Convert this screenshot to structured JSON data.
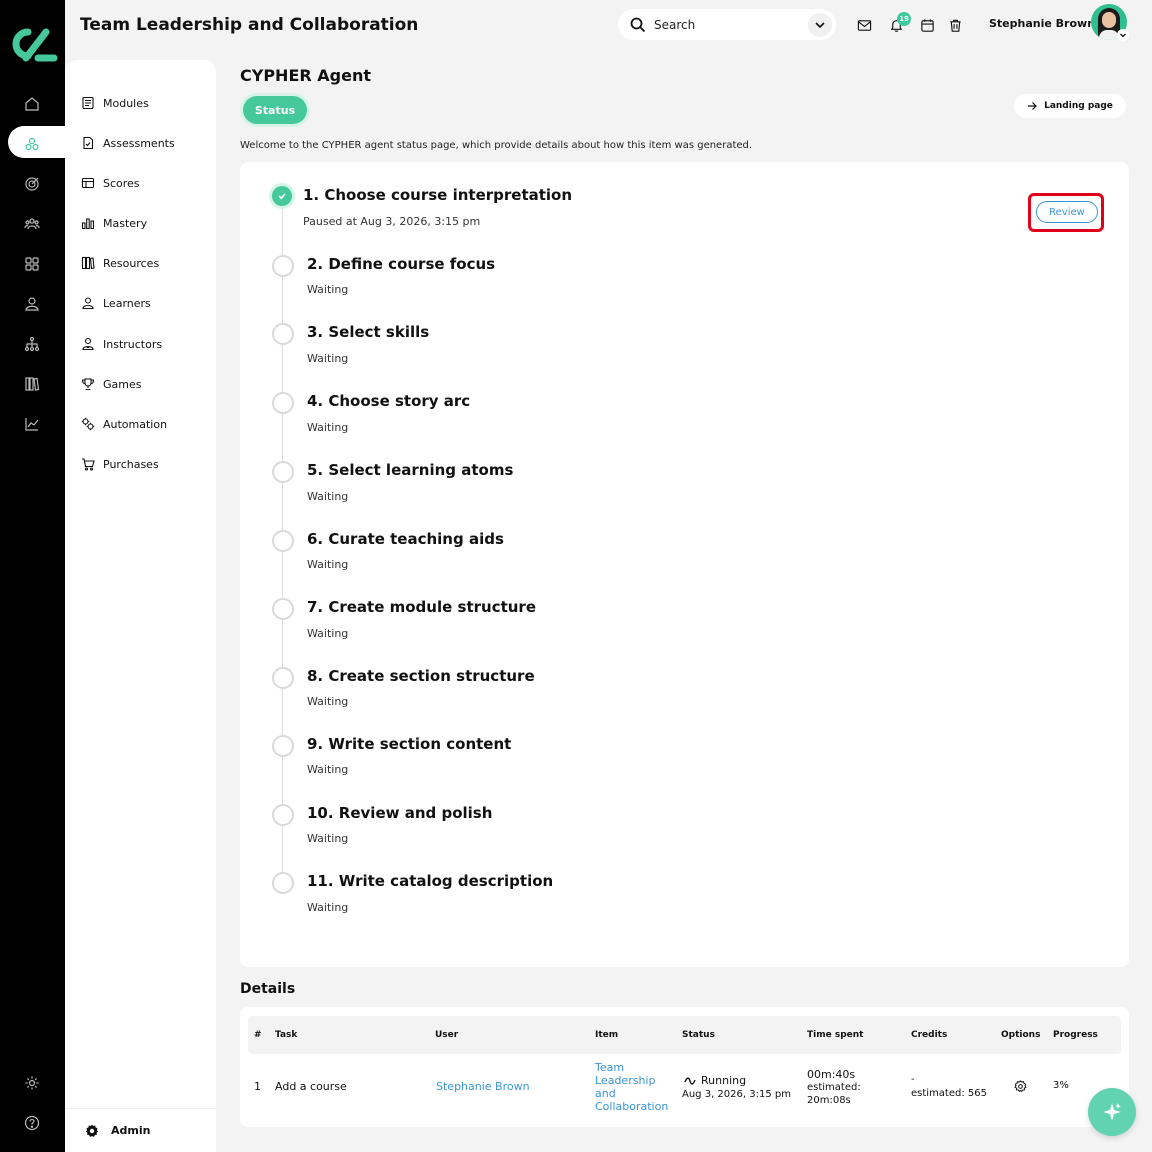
{
  "header": {
    "title": "Team Leadership and Collaboration",
    "search_placeholder": "Search",
    "notification_count": "19",
    "user_name": "Stephanie Brown"
  },
  "colors": {
    "accent": "#45c99b",
    "link": "#3a95d6",
    "highlight": "#e0001b"
  },
  "rail_icons": [
    "home-icon",
    "modules-icon",
    "target-icon",
    "people-icon",
    "grid-icon",
    "user-icon",
    "hierarchy-icon",
    "library-icon",
    "chart-icon",
    "settings-icon",
    "help-icon"
  ],
  "sidebar": {
    "items": [
      {
        "label": "Modules",
        "icon": "modules-icon"
      },
      {
        "label": "Assessments",
        "icon": "assessments-icon"
      },
      {
        "label": "Scores",
        "icon": "scores-icon"
      },
      {
        "label": "Mastery",
        "icon": "mastery-icon"
      },
      {
        "label": "Resources",
        "icon": "resources-icon"
      },
      {
        "label": "Learners",
        "icon": "learners-icon"
      },
      {
        "label": "Instructors",
        "icon": "instructors-icon"
      },
      {
        "label": "Games",
        "icon": "games-icon"
      },
      {
        "label": "Automation",
        "icon": "automation-icon"
      },
      {
        "label": "Purchases",
        "icon": "purchases-icon"
      }
    ],
    "admin_label": "Admin"
  },
  "main": {
    "title": "CYPHER Agent",
    "status_tab": "Status",
    "landing_label": "Landing page",
    "intro": "Welcome to the CYPHER agent status page, which provide details about how this item was generated.",
    "review_label": "Review",
    "steps": [
      {
        "title": "1. Choose course interpretation",
        "status": "Paused at Aug 3, 2026, 3:15 pm",
        "done": true
      },
      {
        "title": "2. Define course focus",
        "status": "Waiting",
        "done": false
      },
      {
        "title": "3. Select skills",
        "status": "Waiting",
        "done": false
      },
      {
        "title": "4. Choose story arc",
        "status": "Waiting",
        "done": false
      },
      {
        "title": "5. Select learning atoms",
        "status": "Waiting",
        "done": false
      },
      {
        "title": "6. Curate teaching aids",
        "status": "Waiting",
        "done": false
      },
      {
        "title": "7. Create module structure",
        "status": "Waiting",
        "done": false
      },
      {
        "title": "8. Create section structure",
        "status": "Waiting",
        "done": false
      },
      {
        "title": "9. Write section content",
        "status": "Waiting",
        "done": false
      },
      {
        "title": "10. Review and polish",
        "status": "Waiting",
        "done": false
      },
      {
        "title": "11. Write catalog description",
        "status": "Waiting",
        "done": false
      }
    ]
  },
  "details": {
    "title": "Details",
    "columns": [
      "#",
      "Task",
      "User",
      "Item",
      "Status",
      "Time spent",
      "Credits",
      "Options",
      "Progress"
    ],
    "row": {
      "num": "1",
      "task": "Add a course",
      "user": "Stephanie Brown",
      "item_lines": [
        "Team",
        "Leadership",
        "and",
        "Collaboration"
      ],
      "status": "Running",
      "status_date": "Aug 3, 2026, 3:15 pm",
      "time_lines": [
        "00m:40s",
        "estimated:",
        "20m:08s"
      ],
      "credits": "-",
      "credits_estimated": "estimated: 565",
      "progress": "3%"
    }
  }
}
